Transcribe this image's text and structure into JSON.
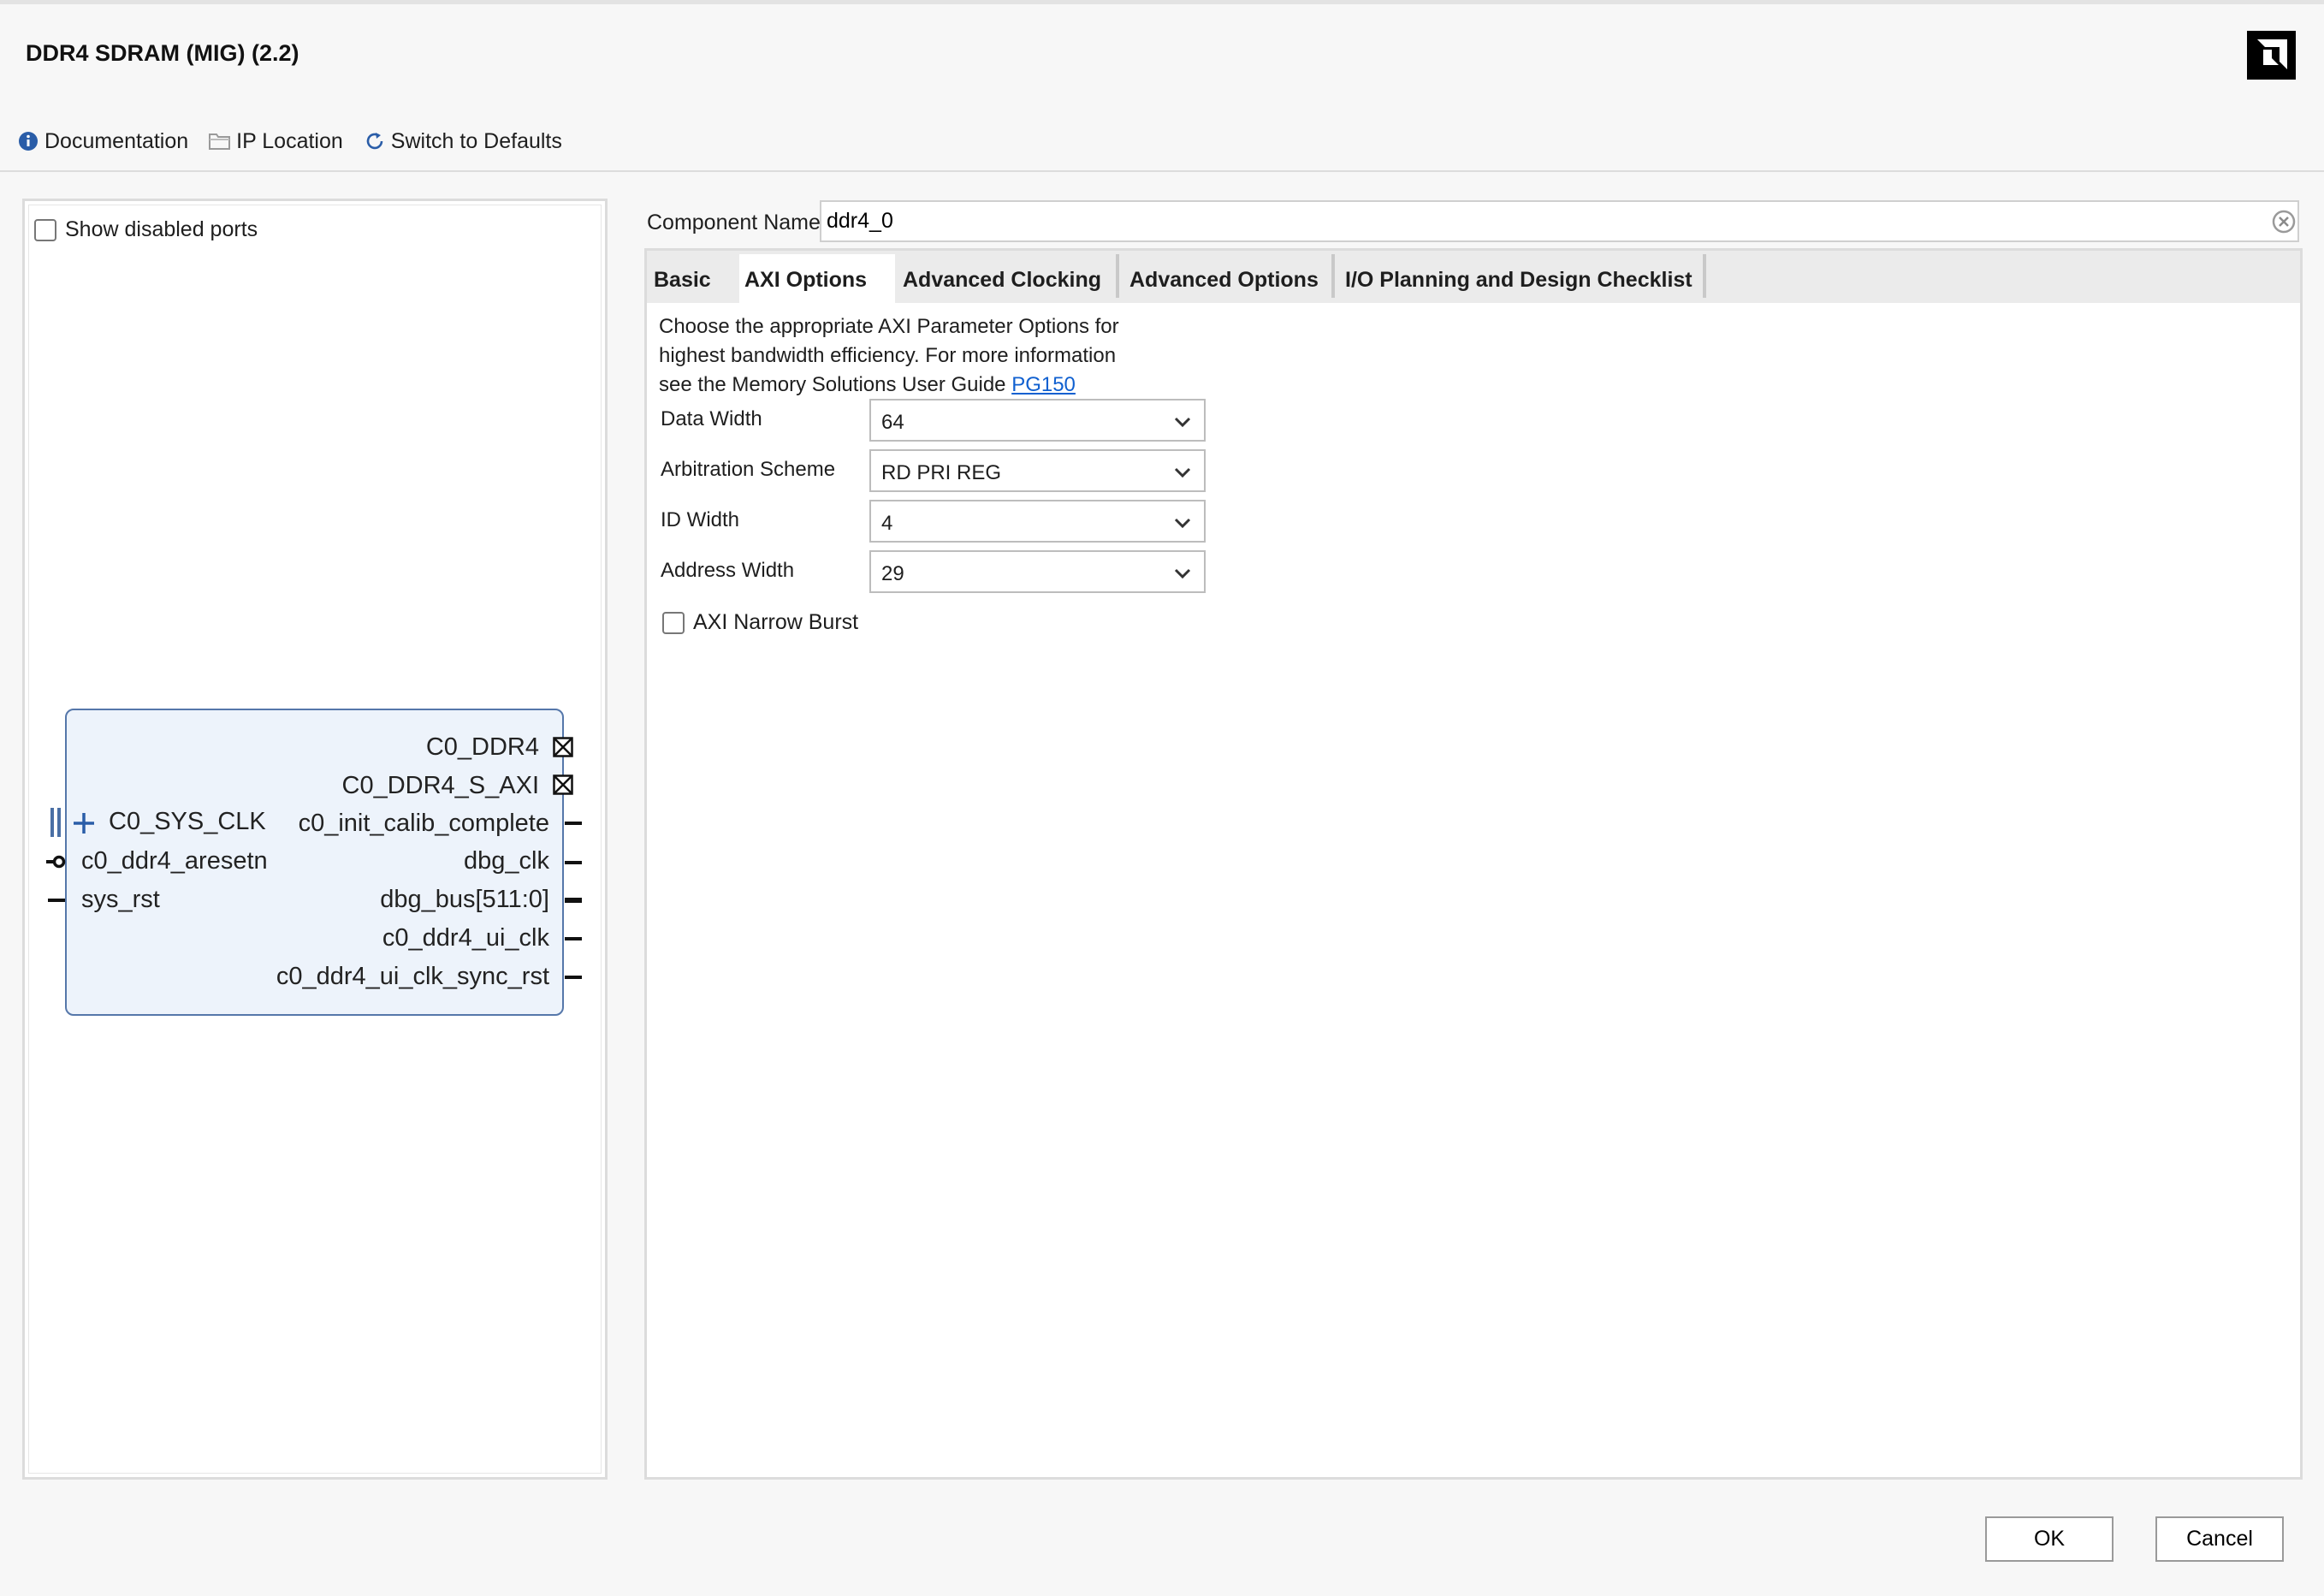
{
  "window": {
    "title": "DDR4 SDRAM (MIG) (2.2)",
    "logo_icon": "amd-logo-icon"
  },
  "toolbar": {
    "documentation": "Documentation",
    "ip_location": "IP Location",
    "switch_defaults": "Switch to Defaults"
  },
  "left_panel": {
    "show_disabled_ports": "Show disabled ports",
    "show_disabled_ports_checked": false,
    "block": {
      "left_ports": [
        "C0_SYS_CLK",
        "c0_ddr4_aresetn",
        "sys_rst"
      ],
      "right_ports": [
        "C0_DDR4",
        "C0_DDR4_S_AXI",
        "c0_init_calib_complete",
        "dbg_clk",
        "dbg_bus[511:0]",
        "c0_ddr4_ui_clk",
        "c0_ddr4_ui_clk_sync_rst"
      ]
    }
  },
  "component": {
    "label": "Component Name",
    "value": "ddr4_0"
  },
  "tabs": [
    {
      "label": "Basic",
      "active": false
    },
    {
      "label": "AXI Options",
      "active": true
    },
    {
      "label": "Advanced Clocking",
      "active": false
    },
    {
      "label": "Advanced Options",
      "active": false
    },
    {
      "label": "I/O Planning and Design Checklist",
      "active": false
    }
  ],
  "axi_options": {
    "description_line1": "Choose the appropriate AXI Parameter Options for",
    "description_line2": "highest bandwidth efficiency. For more information",
    "description_line3": "see the Memory Solutions User Guide ",
    "link": "PG150",
    "fields": [
      {
        "label": "Data Width",
        "value": "64"
      },
      {
        "label": "Arbitration Scheme",
        "value": "RD PRI REG"
      },
      {
        "label": "ID Width",
        "value": "4"
      },
      {
        "label": "Address Width",
        "value": "29"
      }
    ],
    "narrow_burst_label": "AXI Narrow Burst",
    "narrow_burst_checked": false
  },
  "buttons": {
    "ok": "OK",
    "cancel": "Cancel"
  },
  "colors": {
    "accent_link": "#1060d0",
    "block_fill": "#edf3fb",
    "block_border": "#5577aa"
  }
}
